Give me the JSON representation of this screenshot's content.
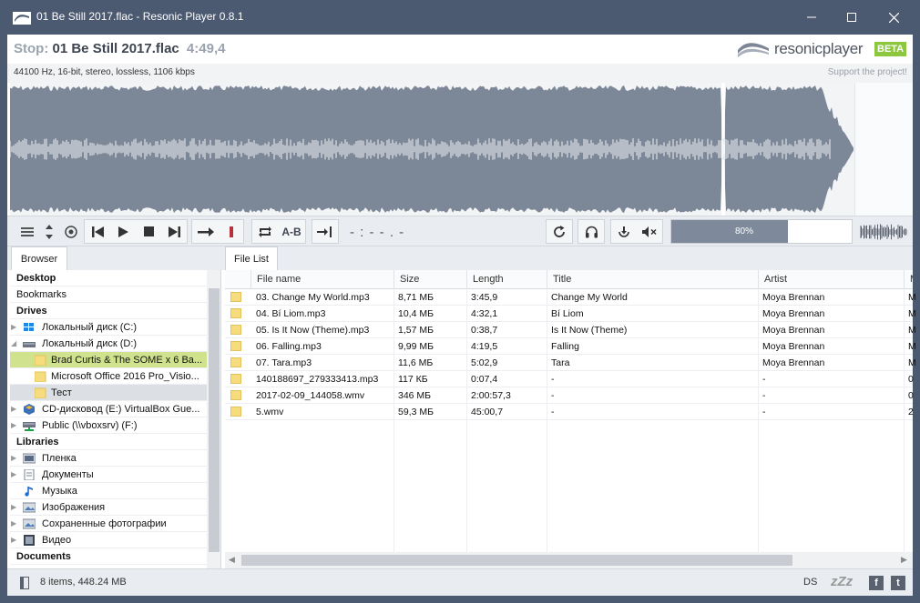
{
  "window": {
    "title": "01 Be Still 2017.flac - Resonic Player 0.8.1",
    "minimize_icon": "minimize-icon",
    "maximize_icon": "maximize-icon",
    "close_icon": "close-icon"
  },
  "header": {
    "state_label": "Stop:",
    "file_name": "01 Be Still 2017.flac",
    "duration": "4:49,4",
    "logo_text": "resonicplayer",
    "beta_badge": "BETA"
  },
  "infobar": {
    "format": "44100 Hz, 16-bit, stereo, lossless, 1106 kbps",
    "support_link": "Support the project!"
  },
  "toolbar": {
    "time_display": "- : - - . -",
    "ab_label": "A-B",
    "volume_label": "80%",
    "volume_fraction": 0.8
  },
  "tabs": {
    "browser": "Browser",
    "file_list": "File List"
  },
  "browser": {
    "sections": {
      "desktop": "Desktop",
      "bookmarks": "Bookmarks",
      "drives": "Drives",
      "libraries": "Libraries",
      "documents": "Documents"
    },
    "drives": [
      "Локальный диск (C:)",
      "Локальный диск (D:)",
      "Brad Curtis & The SOME x 6 Ba...",
      "Microsoft Office 2016 Pro_Visio...",
      "Тест",
      "CD-дисковод (E:) VirtualBox Gue...",
      "Public (\\\\vboxsrv) (F:)"
    ],
    "libraries": [
      "Пленка",
      "Документы",
      "Музыка",
      "Изображения",
      "Сохраненные фотографии",
      "Видео"
    ]
  },
  "filelist": {
    "columns": [
      "File name",
      "Size",
      "Length",
      "Title",
      "Artist",
      "M"
    ],
    "rows": [
      {
        "name": "03. Change My World.mp3",
        "size": "8,71 МБ",
        "length": "3:45,9",
        "title": "Change My World",
        "artist": "Moya Brennan",
        "m": "M"
      },
      {
        "name": "04. Bí Liom.mp3",
        "size": "10,4 МБ",
        "length": "4:32,1",
        "title": "Bí Liom",
        "artist": "Moya Brennan",
        "m": "M"
      },
      {
        "name": "05. Is It Now (Theme).mp3",
        "size": "1,57 МБ",
        "length": "0:38,7",
        "title": "Is It Now (Theme)",
        "artist": "Moya Brennan",
        "m": "M"
      },
      {
        "name": "06. Falling.mp3",
        "size": "9,99 МБ",
        "length": "4:19,5",
        "title": "Falling",
        "artist": "Moya Brennan",
        "m": "M"
      },
      {
        "name": "07. Tara.mp3",
        "size": "11,6 МБ",
        "length": "5:02,9",
        "title": "Tara",
        "artist": "Moya Brennan",
        "m": "M"
      },
      {
        "name": "140188697_279333413.mp3",
        "size": "117 КБ",
        "length": "0:07,4",
        "title": "-",
        "artist": "-",
        "m": "0"
      },
      {
        "name": "2017-02-09_144058.wmv",
        "size": "346 МБ",
        "length": "2:00:57,3",
        "title": "-",
        "artist": "-",
        "m": "0"
      },
      {
        "name": "5.wmv",
        "size": "59,3 МБ",
        "length": "45:00,7",
        "title": "-",
        "artist": "-",
        "m": "2"
      }
    ]
  },
  "status": {
    "summary": "8 items, 448.24 MB",
    "ds_label": "DS",
    "sleep_label": "zZz",
    "facebook_glyph": "f",
    "twitter_glyph": "t"
  },
  "colors": {
    "titlebar": "#4b5971",
    "waveform": "#7c8797",
    "accent_green": "#8dc63f",
    "selection": "#d1e28e"
  }
}
